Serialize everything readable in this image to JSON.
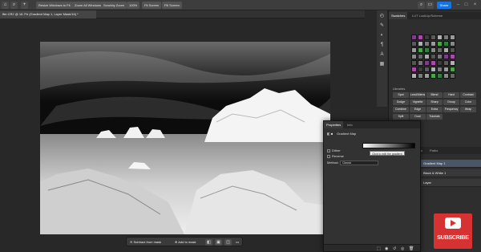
{
  "app": {
    "options_bar": {
      "buttons": [
        "Resize Windows to Fit",
        "Zoom All Windows",
        "Scrubby Zoom",
        "100%",
        "Fit Screen",
        "Fill Screen"
      ],
      "share_label": "Share"
    },
    "doc_tab": "ffer.CR2 @ 16.7% (Gradient Map 1, Layer Mask/16) *"
  },
  "taskbar": {
    "subtract_label": "Subtract from mask",
    "add_label": "Add to mask",
    "more_label": "•••"
  },
  "right_panel": {
    "tabs": [
      "Swatches",
      "LUT LookUp/Scheme"
    ],
    "section_label": "Libraries",
    "action_labels": [
      "Spot",
      "Land/Aliens",
      "Blend",
      "Hard",
      "Contrast",
      "Dodge",
      "Vignette",
      "Sharp",
      "Group",
      "Color",
      "Combine",
      "Edge",
      "Extra",
      "Frequency",
      "Wrap",
      "Split",
      "Dual",
      "Tutorials"
    ],
    "layer_tabs": [
      "Layers",
      "Channels",
      "Paths"
    ],
    "layers": [
      "Gradient Map 1",
      "Black & White 1",
      "Layer"
    ]
  },
  "properties": {
    "tabs": [
      "Properties",
      "Info"
    ],
    "title": "Gradient Map",
    "tooltip": "Click to edit the gradient",
    "dither_label": "Dither",
    "reverse_label": "Reverse",
    "method_label": "Method:",
    "method_value": "Classic"
  },
  "badge": {
    "subscribe_text": "SUBSCRIBE"
  },
  "colors": {
    "accent": "#1473e6",
    "subscribe": "#d63232"
  }
}
